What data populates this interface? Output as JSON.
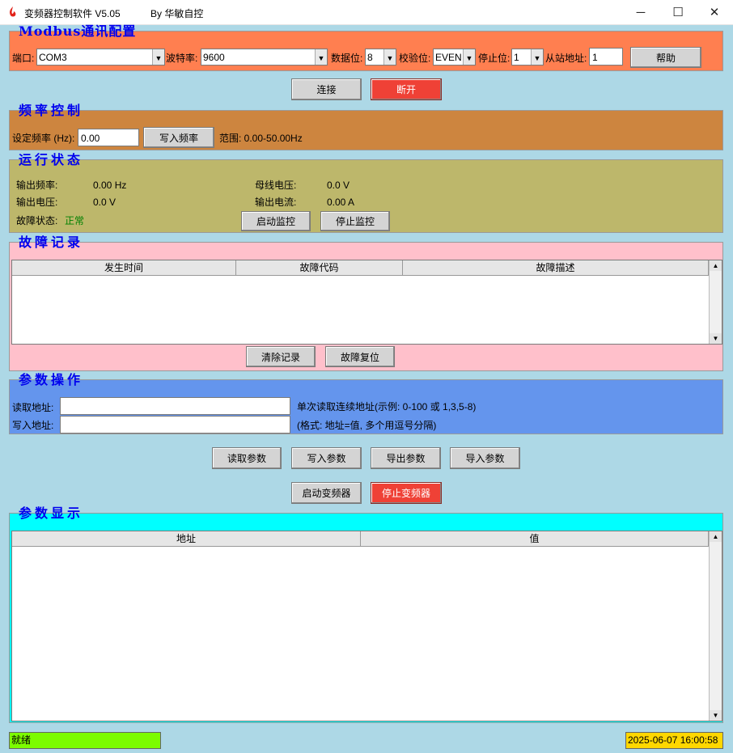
{
  "window": {
    "title": "变频器控制软件 V5.05",
    "author": "By 华敏自控",
    "min_glyph": "─",
    "max_glyph": "☐",
    "close_glyph": "✕"
  },
  "modbus": {
    "title": "Modbus通讯配置",
    "port_label": "端口:",
    "port_value": "COM3",
    "baud_label": "波特率:",
    "baud_value": "9600",
    "databits_label": "数据位:",
    "databits_value": "8",
    "parity_label": "校验位:",
    "parity_value": "EVEN",
    "stopbits_label": "停止位:",
    "stopbits_value": "1",
    "slave_label": "从站地址:",
    "slave_value": "1",
    "help_label": "帮助"
  },
  "connection": {
    "connect_label": "连接",
    "disconnect_label": "断开"
  },
  "frequency": {
    "title": "频率控制",
    "set_label": "设定频率 (Hz):",
    "set_value": "0.00",
    "write_label": "写入频率",
    "range_text": "范围: 0.00-50.00Hz"
  },
  "status": {
    "title": "运行状态",
    "out_freq_label": "输出频率:",
    "out_freq_value": "0.00 Hz",
    "bus_volt_label": "母线电压:",
    "bus_volt_value": "0.0 V",
    "out_volt_label": "输出电压:",
    "out_volt_value": "0.0 V",
    "out_curr_label": "输出电流:",
    "out_curr_value": "0.00 A",
    "fault_label": "故障状态:",
    "fault_value": "正常",
    "start_monitor_label": "启动监控",
    "stop_monitor_label": "停止监控"
  },
  "fault_log": {
    "title": "故障记录",
    "columns": [
      "发生时间",
      "故障代码",
      "故障描述"
    ],
    "clear_label": "清除记录",
    "reset_label": "故障复位"
  },
  "param_ops": {
    "title": "参数操作",
    "read_addr_label": "读取地址:",
    "write_addr_label": "写入地址:",
    "read_hint": "单次读取连续地址(示例: 0-100 或 1,3,5-8)",
    "write_hint": "(格式: 地址=值, 多个用逗号分隔)"
  },
  "actions": {
    "read_label": "读取参数",
    "write_label": "写入参数",
    "export_label": "导出参数",
    "import_label": "导入参数",
    "start_inverter_label": "启动变频器",
    "stop_inverter_label": "停止变频器"
  },
  "param_display": {
    "title": "参数显示",
    "columns": [
      "地址",
      "值"
    ]
  },
  "statusbar": {
    "ready_text": "就绪",
    "datetime": "2025-06-07 16:00:58"
  },
  "icons": {
    "scroll_up": "▲",
    "scroll_down": "▼",
    "dropdown": "▼"
  },
  "colors": {
    "modbus_bg": "#ff7f50",
    "frequency_bg": "#cd853f",
    "status_bg": "#bdb76b",
    "fault_bg": "#ffc0cb",
    "params_bg": "#6495ed",
    "display_bg": "#00ffff",
    "ready_bg": "#7cfc00",
    "time_bg": "#ffd700",
    "fault_normal": "#008000"
  }
}
